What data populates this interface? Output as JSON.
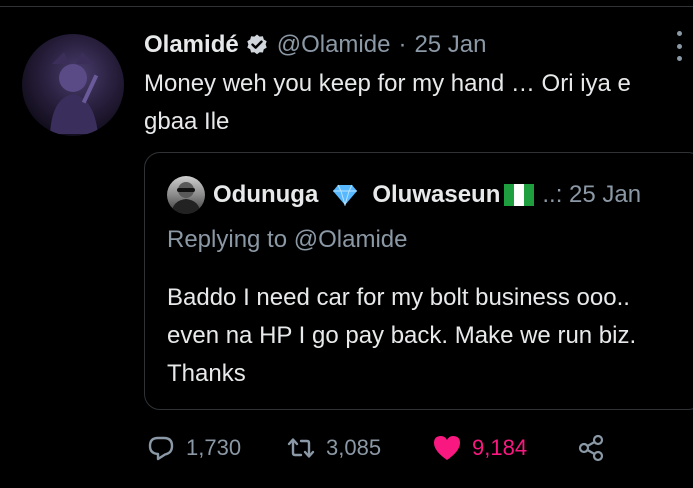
{
  "tweet": {
    "author_name": "Olamidé",
    "handle": "@Olamide",
    "separator": "·",
    "date": "25 Jan",
    "text": "Money weh you keep for my hand … Ori iya e gbaa Ile"
  },
  "quoted_tweet": {
    "name_part1": "Odunuga",
    "name_part2": "Oluwaseun",
    "meta": "..: 25 Jan",
    "replying_prefix": "Replying to",
    "replying_to": "@Olamide",
    "text": "Baddo I need car for my bolt business ooo.. even na HP I go pay back. Make we run biz. Thanks"
  },
  "actions": {
    "replies": "1,730",
    "retweets": "3,085",
    "likes": "9,184"
  },
  "icons": {
    "verified": "verified-badge-icon",
    "gem": "gem-emoji-icon",
    "flag": "nigeria-flag-icon",
    "reply": "reply-icon",
    "retweet": "retweet-icon",
    "like": "heart-icon",
    "share": "share-icon",
    "more": "more-icon"
  },
  "colors": {
    "background": "#000000",
    "text": "#e7e9ea",
    "muted": "#8b98a5",
    "like": "#f91880",
    "border": "#2f3336",
    "gem": "#57b8ff",
    "flag_green": "#1e9e3f"
  }
}
